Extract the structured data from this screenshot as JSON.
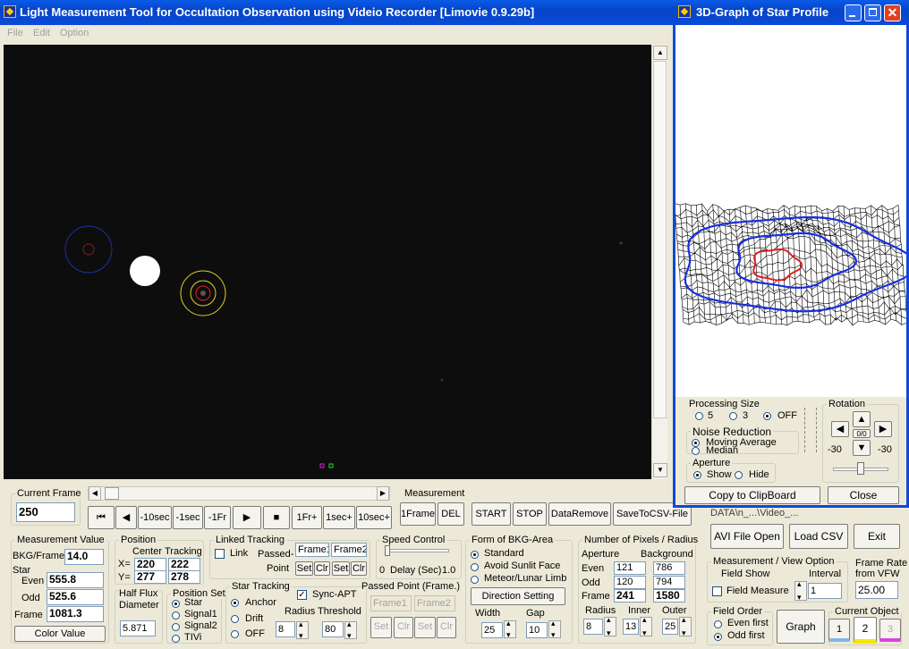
{
  "main_window": {
    "title": "Light Measurement Tool for Occultation Observation using Videio Recorder [Limovie 0.9.29b]",
    "menu": [
      "File",
      "Edit",
      "Option"
    ]
  },
  "current_frame": {
    "label": "Current Frame",
    "value": "250"
  },
  "playback_buttons": [
    "⏮",
    "◀",
    "-10sec",
    "-1sec",
    "-1Fr",
    "▶",
    "■",
    "1Fr+",
    "1sec+",
    "10sec+"
  ],
  "measurement": {
    "label": "Measurement",
    "buttons": {
      "one_frame": "1Frame",
      "del": "DEL",
      "start": "START",
      "stop": "STOP",
      "data_remove": "DataRemove",
      "save_csv": "SaveToCSV-File"
    }
  },
  "measurement_value": {
    "label": "Measurement Value",
    "bkg_label": "BKG/Frame",
    "bkg_value": "14.0",
    "star_label": "Star",
    "even_label": "Even",
    "even_value": "555.8",
    "odd_label": "Odd",
    "odd_value": "525.6",
    "frame_label": "Frame",
    "frame_value": "1081.3",
    "color_button": "Color Value"
  },
  "position": {
    "label": "Position",
    "center_label": "Center",
    "tracking_label": "Tracking",
    "x_label": "X=",
    "y_label": "Y=",
    "x_center": "220",
    "y_center": "277",
    "x_tracking": "222",
    "y_tracking": "278"
  },
  "half_flux": {
    "label1": "Half Flux",
    "label2": "Diameter",
    "value": "5.871"
  },
  "position_set": {
    "label": "Position Set",
    "options": [
      "Star",
      "Signal1",
      "Signal2",
      "TIVi"
    ],
    "selected": 0
  },
  "linked_tracking": {
    "label": "Linked Tracking",
    "link_label": "Link",
    "passed_label": "Passed-",
    "point_label": "Point",
    "frame1": "Frame1",
    "frame2": "Frame2",
    "set": "Set",
    "clr": "Clr"
  },
  "speed_control": {
    "label": "Speed Control",
    "min": "0",
    "delay_label": "Delay (Sec)",
    "max": "1.0"
  },
  "star_tracking": {
    "label": "Star Tracking",
    "options": [
      "Anchor",
      "Drift",
      "OFF"
    ],
    "selected": 0,
    "sync_label": "Sync-APT",
    "radius_label": "Radius",
    "threshold_label": "Threshold",
    "radius_value": "8",
    "threshold_value": "80"
  },
  "passed_point": {
    "label": "Passed Point (Frame.)",
    "frame1": "Frame1",
    "frame2": "Frame2",
    "set": "Set",
    "clr": "Clr"
  },
  "bkg_area": {
    "label": "Form of BKG-Area",
    "options": [
      "Standard",
      "Avoid Sunlit Face",
      "Meteor/Lunar Limb"
    ],
    "selected": 0,
    "direction_button": "Direction Setting",
    "width_label": "Width",
    "gap_label": "Gap",
    "width_value": "25",
    "gap_value": "10"
  },
  "pixels": {
    "label": "Number of Pixels / Radius",
    "aperture_label": "Aperture",
    "background_label": "Background",
    "even_label": "Even",
    "odd_label": "Odd",
    "frame_label": "Frame",
    "even_ap": "121",
    "even_bg": "786",
    "odd_ap": "120",
    "odd_bg": "794",
    "frame_ap": "241",
    "frame_bg": "1580",
    "radius_label": "Radius",
    "inner_label": "Inner",
    "outer_label": "Outer",
    "radius_value": "8",
    "inner_value": "13",
    "outer_value": "25"
  },
  "file_path_text": "DATA\\n_...\\Video_...",
  "file_buttons": {
    "avi_open": "AVI File Open",
    "load_csv": "Load CSV",
    "exit": "Exit"
  },
  "view_option": {
    "label": "Measurement / View Option",
    "field_show": "Field Show",
    "interval_label": "Interval",
    "field_measure": "Field Measure",
    "interval_value": "1"
  },
  "frame_rate": {
    "label1": "Frame Rate",
    "label2": "from VFW",
    "value": "25.00"
  },
  "field_order": {
    "label": "Field Order",
    "options": [
      "Even first",
      "Odd first"
    ],
    "selected": 1
  },
  "graph_button": "Graph",
  "current_object": {
    "label": "Current Object",
    "buttons": [
      "1",
      "2",
      "3"
    ],
    "selected": 1
  },
  "graph_window": {
    "title": "3D-Graph of Star Profile",
    "processing_size": {
      "label": "Processing Size",
      "options": [
        "5",
        "3",
        "OFF"
      ],
      "selected": 2
    },
    "noise_reduction": {
      "label": "Noise Reduction",
      "options": [
        "Moving Average",
        "Median"
      ],
      "selected": 0
    },
    "aperture": {
      "label": "Aperture",
      "options": [
        "Show",
        "Hide"
      ],
      "selected": 0
    },
    "rotation": {
      "label": "Rotation",
      "center": "0/0",
      "left_value": "-30",
      "right_value": "-30"
    },
    "copy_button": "Copy to ClipBoard",
    "close_button": "Close"
  },
  "colors": {
    "title_bar": "#0a4ad8",
    "video_bg": "#0d0d0d",
    "aperture_ring": "#e0d020",
    "bkg_ring": "#2030a0",
    "mesh_blue": "#1a2ee0",
    "mesh_red": "#e02020"
  }
}
